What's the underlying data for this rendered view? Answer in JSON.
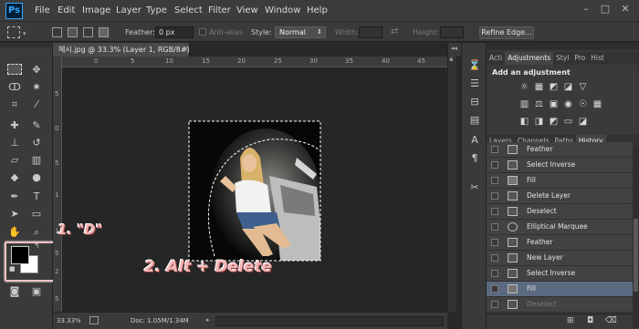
{
  "app": {
    "logo": "Ps"
  },
  "menu": [
    "File",
    "Edit",
    "Image",
    "Layer",
    "Type",
    "Select",
    "Filter",
    "View",
    "Window",
    "Help"
  ],
  "window_controls": {
    "minimize": "–",
    "maximize": "□",
    "close": "✕"
  },
  "options": {
    "feather_label": "Feather:",
    "feather_value": "0 px",
    "antialias_label": "Anti-alias",
    "style_label": "Style:",
    "style_value": "Normal",
    "width_label": "Width:",
    "height_label": "Height:",
    "refine_edge": "Refine Edge..."
  },
  "document": {
    "tab_title": "헤시.jpg @ 33.3% (Layer 1, RGB/8#) *",
    "zoom": "33.33%",
    "doc_info": "Doc: 1.05M/1.34M"
  },
  "ruler_ticks": [
    "5",
    "0",
    "5",
    "10",
    "15",
    "20",
    "25",
    "30",
    "35",
    "40",
    "45"
  ],
  "ruler_v_ticks": [
    "5",
    "0",
    "5",
    "1",
    "1",
    "5",
    "2",
    "5"
  ],
  "annotations": {
    "step1": "1. \"D\"",
    "step2": "2. Alt + Delete"
  },
  "panels": {
    "top_tabs": [
      "Acti",
      "Adjustments",
      "Styl",
      "Pro",
      "Hist"
    ],
    "add_adjustment": "Add an adjustment",
    "bottom_tabs": [
      "Layers",
      "Channels",
      "Paths",
      "History"
    ]
  },
  "history": [
    {
      "label": "Feather",
      "icon": "doc-icon"
    },
    {
      "label": "Select Inverse",
      "icon": "doc-icon"
    },
    {
      "label": "Fill",
      "icon": "fill-icon"
    },
    {
      "label": "Delete Layer",
      "icon": "doc-icon"
    },
    {
      "label": "Deselect",
      "icon": "doc-icon"
    },
    {
      "label": "Elliptical Marquee",
      "icon": "ellipse-icon"
    },
    {
      "label": "Feather",
      "icon": "doc-icon"
    },
    {
      "label": "New Layer",
      "icon": "doc-icon"
    },
    {
      "label": "Select Inverse",
      "icon": "doc-icon"
    },
    {
      "label": "Fill",
      "icon": "fill-icon",
      "selected": true
    },
    {
      "label": "Deselect",
      "icon": "doc-icon",
      "dimmed": true
    }
  ],
  "colors": {
    "accent": "#31a8ff",
    "history_selected": "#5b6a80",
    "annotation": "#f3b6b6"
  }
}
